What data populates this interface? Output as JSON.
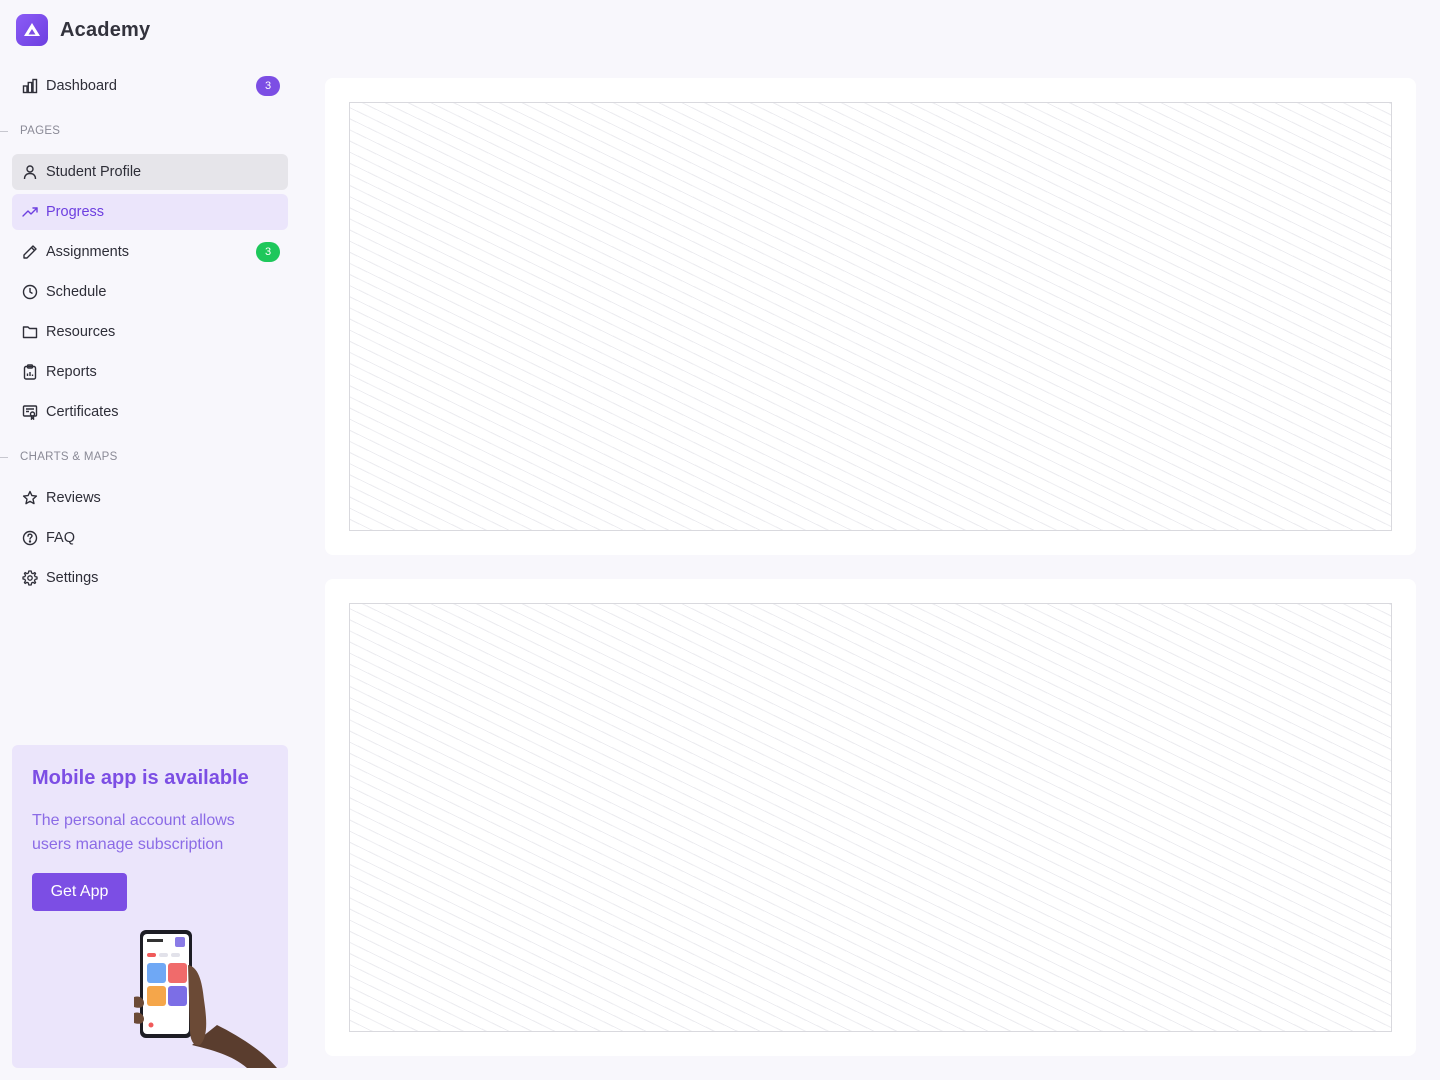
{
  "app": {
    "name": "Academy",
    "accent": "#7c4ee4"
  },
  "nav": {
    "dashboard": {
      "label": "Dashboard",
      "icon": "bar-chart-icon",
      "badge": "3"
    },
    "sections": [
      {
        "label": "PAGES",
        "items": [
          {
            "label": "Student Profile",
            "icon": "user-icon",
            "state": "hover"
          },
          {
            "label": "Progress",
            "icon": "trending-up-icon",
            "state": "active"
          },
          {
            "label": "Assignments",
            "icon": "pencil-icon",
            "badge": "3"
          },
          {
            "label": "Schedule",
            "icon": "clock-icon"
          },
          {
            "label": "Resources",
            "icon": "folder-icon"
          },
          {
            "label": "Reports",
            "icon": "clipboard-icon"
          },
          {
            "label": "Certificates",
            "icon": "certificate-icon"
          }
        ]
      },
      {
        "label": "CHARTS & MAPS",
        "items": [
          {
            "label": "Reviews",
            "icon": "star-icon"
          },
          {
            "label": "FAQ",
            "icon": "help-circle-icon"
          },
          {
            "label": "Settings",
            "icon": "gear-icon"
          }
        ]
      }
    ]
  },
  "promo": {
    "title": "Mobile app is available",
    "text": "The personal account allows users manage subscription",
    "button": "Get App"
  },
  "colors": {
    "badge_purple": "#7c4ee4",
    "badge_green": "#1ec75b",
    "active_bg": "#ebe5fb",
    "hover_bg": "#e6e5ea"
  }
}
